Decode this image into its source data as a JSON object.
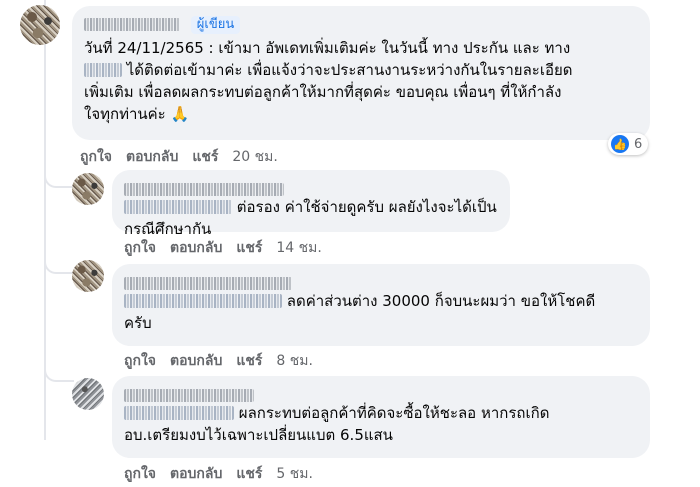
{
  "main_comment": {
    "author_badge": "ผู้เขียน",
    "text_line1": "วันที่ 24/11/2565 : เข้ามา อัพเดทเพิ่มเติมค่ะ ในวันนี้ ทาง ประกัน และ ทาง",
    "text_line2": " ได้ติดต่อเข้ามาค่ะ เพื่อแจ้งว่าจะประสานงานระหว่างกันในรายละเอียด",
    "text_line3": "เพิ่มเติม เพื่อลดผลกระทบต่อลูกค้าให้มากที่สุดค่ะ ขอบคุณ เพื่อนๆ ที่ให้กำลัง",
    "text_line4": "ใจทุกท่านค่ะ 🙏",
    "like_label": "ถูกใจ",
    "reply_label": "ตอบกลับ",
    "share_label": "แชร์",
    "time": "20 ชม.",
    "reaction_count": "6",
    "reaction_icon": "thumbs-up-icon"
  },
  "replies": [
    {
      "text_line1": "ต่อรอง ค่าใช้จ่ายดูครับ ผลยังไงจะได้เป็นกรณีศึกษากัน",
      "like_label": "ถูกใจ",
      "reply_label": "ตอบกลับ",
      "share_label": "แชร์",
      "time": "14 ชม."
    },
    {
      "text_line1": "ลดค่าส่วนต่าง 30000 ก็จบนะผมว่า ขอให้โชคดี",
      "text_line2": "ครับ",
      "like_label": "ถูกใจ",
      "reply_label": "ตอบกลับ",
      "share_label": "แชร์",
      "time": "8 ชม."
    },
    {
      "text_line1": "ผลกระทบต่อลูกค้าที่คิดจะซื้อให้ชะลอ หากรถเกิด",
      "text_line2": "อบ.เตรียมงบไว้เฉพาะเปลี่ยนแบต 6.5แสน",
      "like_label": "ถูกใจ",
      "reply_label": "ตอบกลับ",
      "share_label": "แชร์",
      "time": "5 ชม."
    }
  ]
}
